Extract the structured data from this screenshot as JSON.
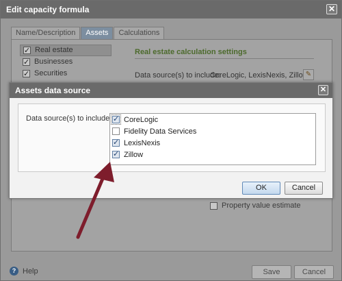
{
  "window": {
    "title": "Edit capacity formula"
  },
  "tabs": [
    {
      "label": "Name/Description"
    },
    {
      "label": "Assets"
    },
    {
      "label": "Calculations"
    }
  ],
  "assets": {
    "items": [
      {
        "label": "Real estate",
        "checked": true
      },
      {
        "label": "Businesses",
        "checked": true
      },
      {
        "label": "Securities",
        "checked": true
      }
    ]
  },
  "settings": {
    "section_title": "Real estate calculation settings",
    "data_sources_label": "Data source(s) to include:",
    "data_sources_value": "CoreLogic, LexisNexis, Zillow",
    "property_value_label": "Property value estimate"
  },
  "footer": {
    "help_label": "Help",
    "help_glyph": "?",
    "save_label": "Save",
    "cancel_label": "Cancel"
  },
  "dialog": {
    "title": "Assets data source",
    "label": "Data source(s) to include:",
    "sources": [
      {
        "label": "CoreLogic",
        "checked": true
      },
      {
        "label": "Fidelity Data Services",
        "checked": false
      },
      {
        "label": "LexisNexis",
        "checked": true
      },
      {
        "label": "Zillow",
        "checked": true
      }
    ],
    "ok_label": "OK",
    "cancel_label": "Cancel",
    "close_glyph": "✕"
  },
  "colors": {
    "titlebar": "#6a6a6a",
    "arrow": "#7e1d2c",
    "section_title": "#4c6a2c"
  }
}
